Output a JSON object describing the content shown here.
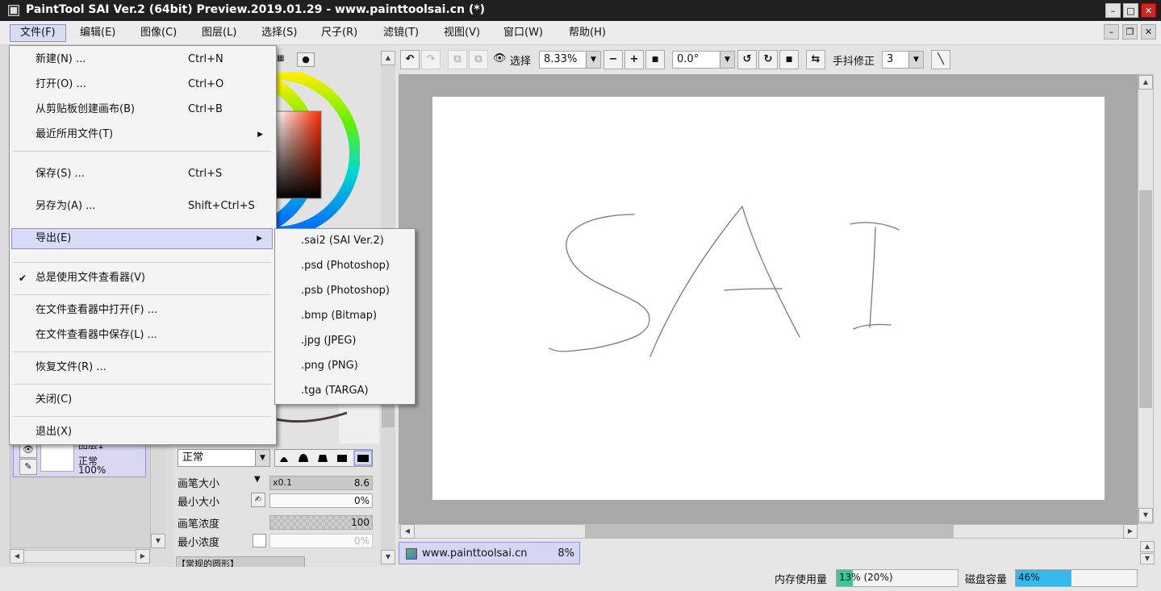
{
  "window": {
    "title": "PaintTool SAI Ver.2 (64bit) Preview.2019.01.29 - www.painttoolsai.cn (*)",
    "controls": {
      "minimize": "–",
      "maximize": "□",
      "close": "✕"
    }
  },
  "menubar": {
    "items": [
      "文件(F)",
      "编辑(E)",
      "图像(C)",
      "图层(L)",
      "选择(S)",
      "尺子(R)",
      "滤镜(T)",
      "视图(V)",
      "窗口(W)",
      "帮助(H)"
    ],
    "active": "文件(F)",
    "mdi_controls": {
      "minimize": "–",
      "restore": "❐",
      "close": "✕"
    }
  },
  "file_menu": {
    "items": [
      {
        "label": "新建(N) ...",
        "shortcut": "Ctrl+N"
      },
      {
        "label": "打开(O) ...",
        "shortcut": "Ctrl+O"
      },
      {
        "label": "从剪贴板创建画布(B)",
        "shortcut": "Ctrl+B"
      },
      {
        "label": "最近所用文件(T)",
        "submenu_arrow": "▶"
      },
      {
        "label": "保存(S) ...",
        "shortcut": "Ctrl+S"
      },
      {
        "label": "另存为(A) ...",
        "shortcut": "Shift+Ctrl+S"
      },
      {
        "label": "导出(E)",
        "submenu_arrow": "▶"
      },
      {
        "label": "总是使用文件查看器(V)",
        "checkmark": "✔"
      },
      {
        "label": "在文件查看器中打开(F) ..."
      },
      {
        "label": "在文件查看器中保存(L) ..."
      },
      {
        "label": "恢复文件(R) ..."
      },
      {
        "label": "关闭(C)"
      },
      {
        "label": "退出(X)"
      }
    ]
  },
  "export_submenu": {
    "items": [
      ".sai2 (SAI Ver.2)",
      ".psd (Photoshop)",
      ".psb (Photoshop)",
      ".bmp (Bitmap)",
      ".jpg (JPEG)",
      ".png (PNG)",
      ".tga (TARGA)"
    ]
  },
  "toolbar": {
    "undo_icon": "undo-icon",
    "redo_icon": "redo-icon",
    "selection_label": "选择",
    "zoom_value": "8.33%",
    "zoom_out": "−",
    "zoom_in": "+",
    "zoom_reset": "■",
    "rotation_value": "0.0°",
    "rotate_ccw": "↺",
    "rotate_cw": "↻",
    "rotate_reset": "■",
    "flip": "⇆",
    "stabilizer_label": "手抖修正",
    "stabilizer_value": "3",
    "line_tool": "╲"
  },
  "layers": {
    "layer_name": "图层1",
    "blend_mode": "正常",
    "opacity": "100%"
  },
  "brush_panel": {
    "blend_mode": "正常",
    "brush_size_label": "画笔大小",
    "brush_size_multiplier": "x0.1",
    "brush_size_value": "8.6",
    "min_size_label": "最小大小",
    "min_size_value": "0%",
    "density_label": "画笔浓度",
    "density_value": "100",
    "min_density_label": "最小浓度",
    "min_density_value": "0%",
    "preset_label": "【常规的圆形】"
  },
  "canvas": {
    "stroke_color": "#8a7272"
  },
  "doc_tab": {
    "name": "www.painttoolsai.cn",
    "zoom": "8%"
  },
  "status": {
    "memory_label": "内存使用量",
    "memory_text": "13% (20%)",
    "memory_fraction": 0.13,
    "disk_label": "磁盘容量",
    "disk_text": "46%",
    "disk_fraction": 0.46,
    "memory_color": "#3cc59a",
    "disk_color": "#35b8ec"
  },
  "colors": {
    "menu_highlight": "#d8dcf8",
    "menu_highlight_border": "#8b93c9",
    "titlebar": "#202020",
    "close_button": "#c82828"
  }
}
